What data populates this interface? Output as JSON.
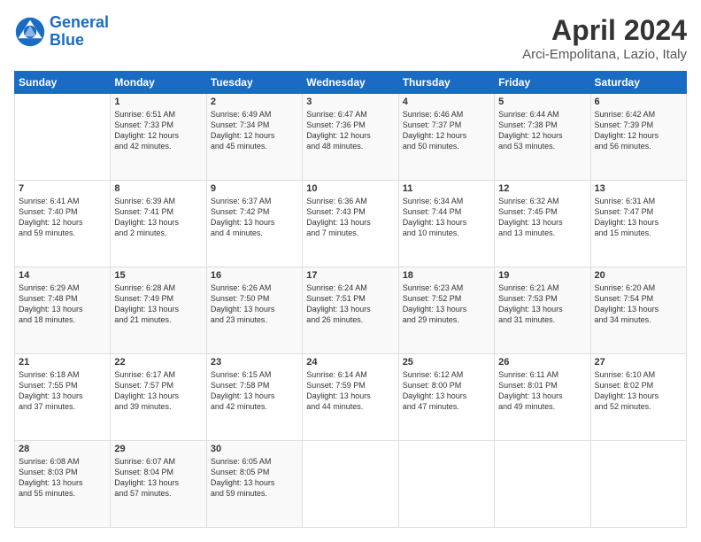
{
  "header": {
    "logo_line1": "General",
    "logo_line2": "Blue",
    "title": "April 2024",
    "subtitle": "Arci-Empolitana, Lazio, Italy"
  },
  "days_of_week": [
    "Sunday",
    "Monday",
    "Tuesday",
    "Wednesday",
    "Thursday",
    "Friday",
    "Saturday"
  ],
  "weeks": [
    [
      {
        "day": "",
        "info": ""
      },
      {
        "day": "1",
        "info": "Sunrise: 6:51 AM\nSunset: 7:33 PM\nDaylight: 12 hours\nand 42 minutes."
      },
      {
        "day": "2",
        "info": "Sunrise: 6:49 AM\nSunset: 7:34 PM\nDaylight: 12 hours\nand 45 minutes."
      },
      {
        "day": "3",
        "info": "Sunrise: 6:47 AM\nSunset: 7:36 PM\nDaylight: 12 hours\nand 48 minutes."
      },
      {
        "day": "4",
        "info": "Sunrise: 6:46 AM\nSunset: 7:37 PM\nDaylight: 12 hours\nand 50 minutes."
      },
      {
        "day": "5",
        "info": "Sunrise: 6:44 AM\nSunset: 7:38 PM\nDaylight: 12 hours\nand 53 minutes."
      },
      {
        "day": "6",
        "info": "Sunrise: 6:42 AM\nSunset: 7:39 PM\nDaylight: 12 hours\nand 56 minutes."
      }
    ],
    [
      {
        "day": "7",
        "info": "Sunrise: 6:41 AM\nSunset: 7:40 PM\nDaylight: 12 hours\nand 59 minutes."
      },
      {
        "day": "8",
        "info": "Sunrise: 6:39 AM\nSunset: 7:41 PM\nDaylight: 13 hours\nand 2 minutes."
      },
      {
        "day": "9",
        "info": "Sunrise: 6:37 AM\nSunset: 7:42 PM\nDaylight: 13 hours\nand 4 minutes."
      },
      {
        "day": "10",
        "info": "Sunrise: 6:36 AM\nSunset: 7:43 PM\nDaylight: 13 hours\nand 7 minutes."
      },
      {
        "day": "11",
        "info": "Sunrise: 6:34 AM\nSunset: 7:44 PM\nDaylight: 13 hours\nand 10 minutes."
      },
      {
        "day": "12",
        "info": "Sunrise: 6:32 AM\nSunset: 7:45 PM\nDaylight: 13 hours\nand 13 minutes."
      },
      {
        "day": "13",
        "info": "Sunrise: 6:31 AM\nSunset: 7:47 PM\nDaylight: 13 hours\nand 15 minutes."
      }
    ],
    [
      {
        "day": "14",
        "info": "Sunrise: 6:29 AM\nSunset: 7:48 PM\nDaylight: 13 hours\nand 18 minutes."
      },
      {
        "day": "15",
        "info": "Sunrise: 6:28 AM\nSunset: 7:49 PM\nDaylight: 13 hours\nand 21 minutes."
      },
      {
        "day": "16",
        "info": "Sunrise: 6:26 AM\nSunset: 7:50 PM\nDaylight: 13 hours\nand 23 minutes."
      },
      {
        "day": "17",
        "info": "Sunrise: 6:24 AM\nSunset: 7:51 PM\nDaylight: 13 hours\nand 26 minutes."
      },
      {
        "day": "18",
        "info": "Sunrise: 6:23 AM\nSunset: 7:52 PM\nDaylight: 13 hours\nand 29 minutes."
      },
      {
        "day": "19",
        "info": "Sunrise: 6:21 AM\nSunset: 7:53 PM\nDaylight: 13 hours\nand 31 minutes."
      },
      {
        "day": "20",
        "info": "Sunrise: 6:20 AM\nSunset: 7:54 PM\nDaylight: 13 hours\nand 34 minutes."
      }
    ],
    [
      {
        "day": "21",
        "info": "Sunrise: 6:18 AM\nSunset: 7:55 PM\nDaylight: 13 hours\nand 37 minutes."
      },
      {
        "day": "22",
        "info": "Sunrise: 6:17 AM\nSunset: 7:57 PM\nDaylight: 13 hours\nand 39 minutes."
      },
      {
        "day": "23",
        "info": "Sunrise: 6:15 AM\nSunset: 7:58 PM\nDaylight: 13 hours\nand 42 minutes."
      },
      {
        "day": "24",
        "info": "Sunrise: 6:14 AM\nSunset: 7:59 PM\nDaylight: 13 hours\nand 44 minutes."
      },
      {
        "day": "25",
        "info": "Sunrise: 6:12 AM\nSunset: 8:00 PM\nDaylight: 13 hours\nand 47 minutes."
      },
      {
        "day": "26",
        "info": "Sunrise: 6:11 AM\nSunset: 8:01 PM\nDaylight: 13 hours\nand 49 minutes."
      },
      {
        "day": "27",
        "info": "Sunrise: 6:10 AM\nSunset: 8:02 PM\nDaylight: 13 hours\nand 52 minutes."
      }
    ],
    [
      {
        "day": "28",
        "info": "Sunrise: 6:08 AM\nSunset: 8:03 PM\nDaylight: 13 hours\nand 55 minutes."
      },
      {
        "day": "29",
        "info": "Sunrise: 6:07 AM\nSunset: 8:04 PM\nDaylight: 13 hours\nand 57 minutes."
      },
      {
        "day": "30",
        "info": "Sunrise: 6:05 AM\nSunset: 8:05 PM\nDaylight: 13 hours\nand 59 minutes."
      },
      {
        "day": "",
        "info": ""
      },
      {
        "day": "",
        "info": ""
      },
      {
        "day": "",
        "info": ""
      },
      {
        "day": "",
        "info": ""
      }
    ]
  ]
}
